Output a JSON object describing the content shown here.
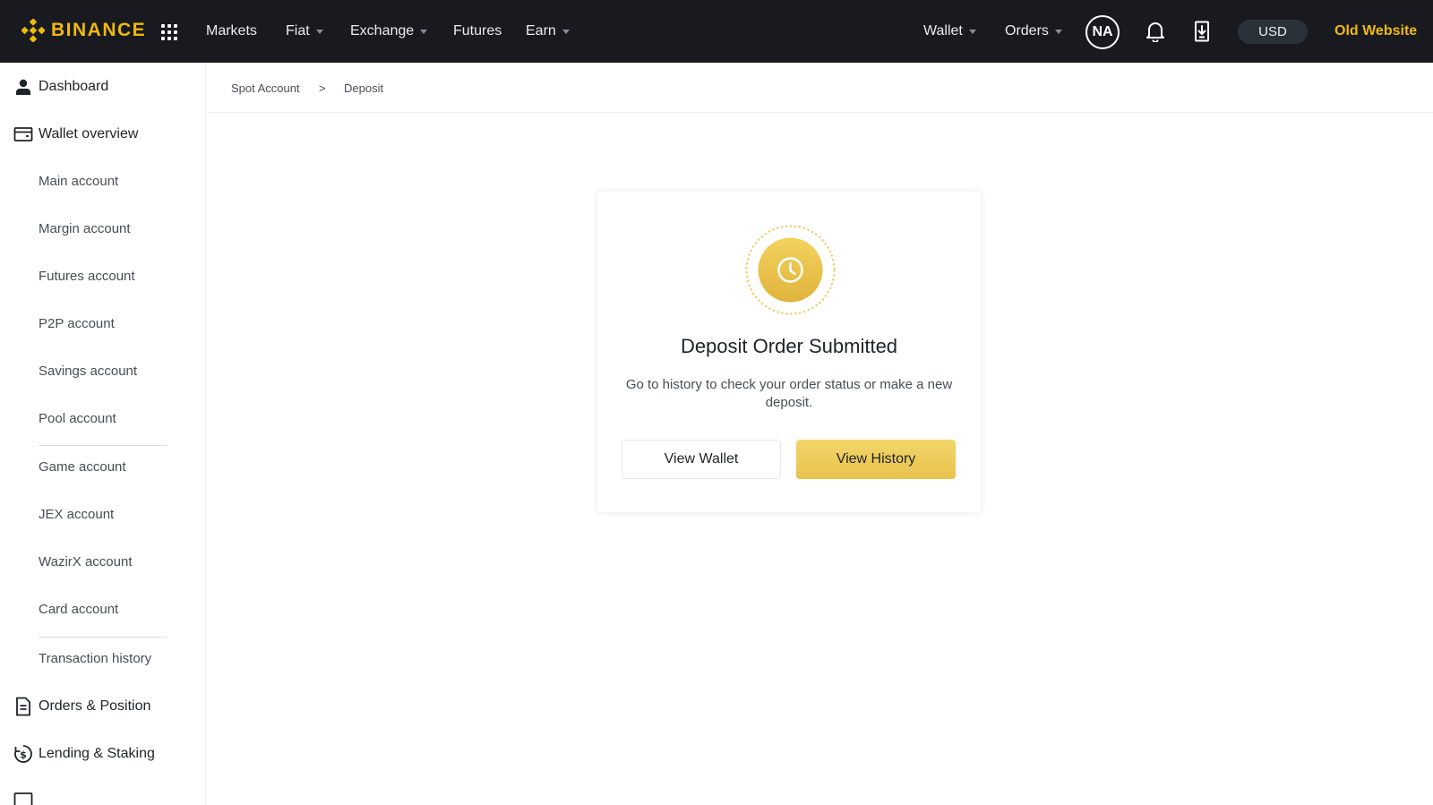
{
  "header": {
    "brand": "BINANCE",
    "nav": [
      {
        "label": "Markets",
        "caret": false
      },
      {
        "label": "Fiat",
        "caret": true
      },
      {
        "label": "Exchange",
        "caret": true
      },
      {
        "label": "Futures",
        "caret": false
      },
      {
        "label": "Earn",
        "caret": true
      }
    ],
    "wallet_label": "Wallet",
    "orders_label": "Orders",
    "avatar_initials": "NA",
    "currency": "USD",
    "old_website_label": "Old Website"
  },
  "sidebar": {
    "dashboard": "Dashboard",
    "wallet_overview": "Wallet overview",
    "accounts": [
      "Main account",
      "Margin account",
      "Futures account",
      "P2P account",
      "Savings account",
      "Pool account",
      "Game account",
      "JEX account",
      "WazirX account",
      "Card account",
      "Transaction history"
    ],
    "orders_position": "Orders & Position",
    "lending_staking": "Lending & Staking"
  },
  "breadcrumb": {
    "parent": "Spot Account",
    "separator": ">",
    "current": "Deposit"
  },
  "card": {
    "title": "Deposit Order Submitted",
    "description": "Go to history to check your order status or make a new deposit.",
    "view_wallet_label": "View Wallet",
    "view_history_label": "View History",
    "icon": "clock-icon"
  },
  "colors": {
    "brand": "#f0b90b",
    "topbar_bg": "#181a20",
    "primary_button": "#efcc5a"
  }
}
